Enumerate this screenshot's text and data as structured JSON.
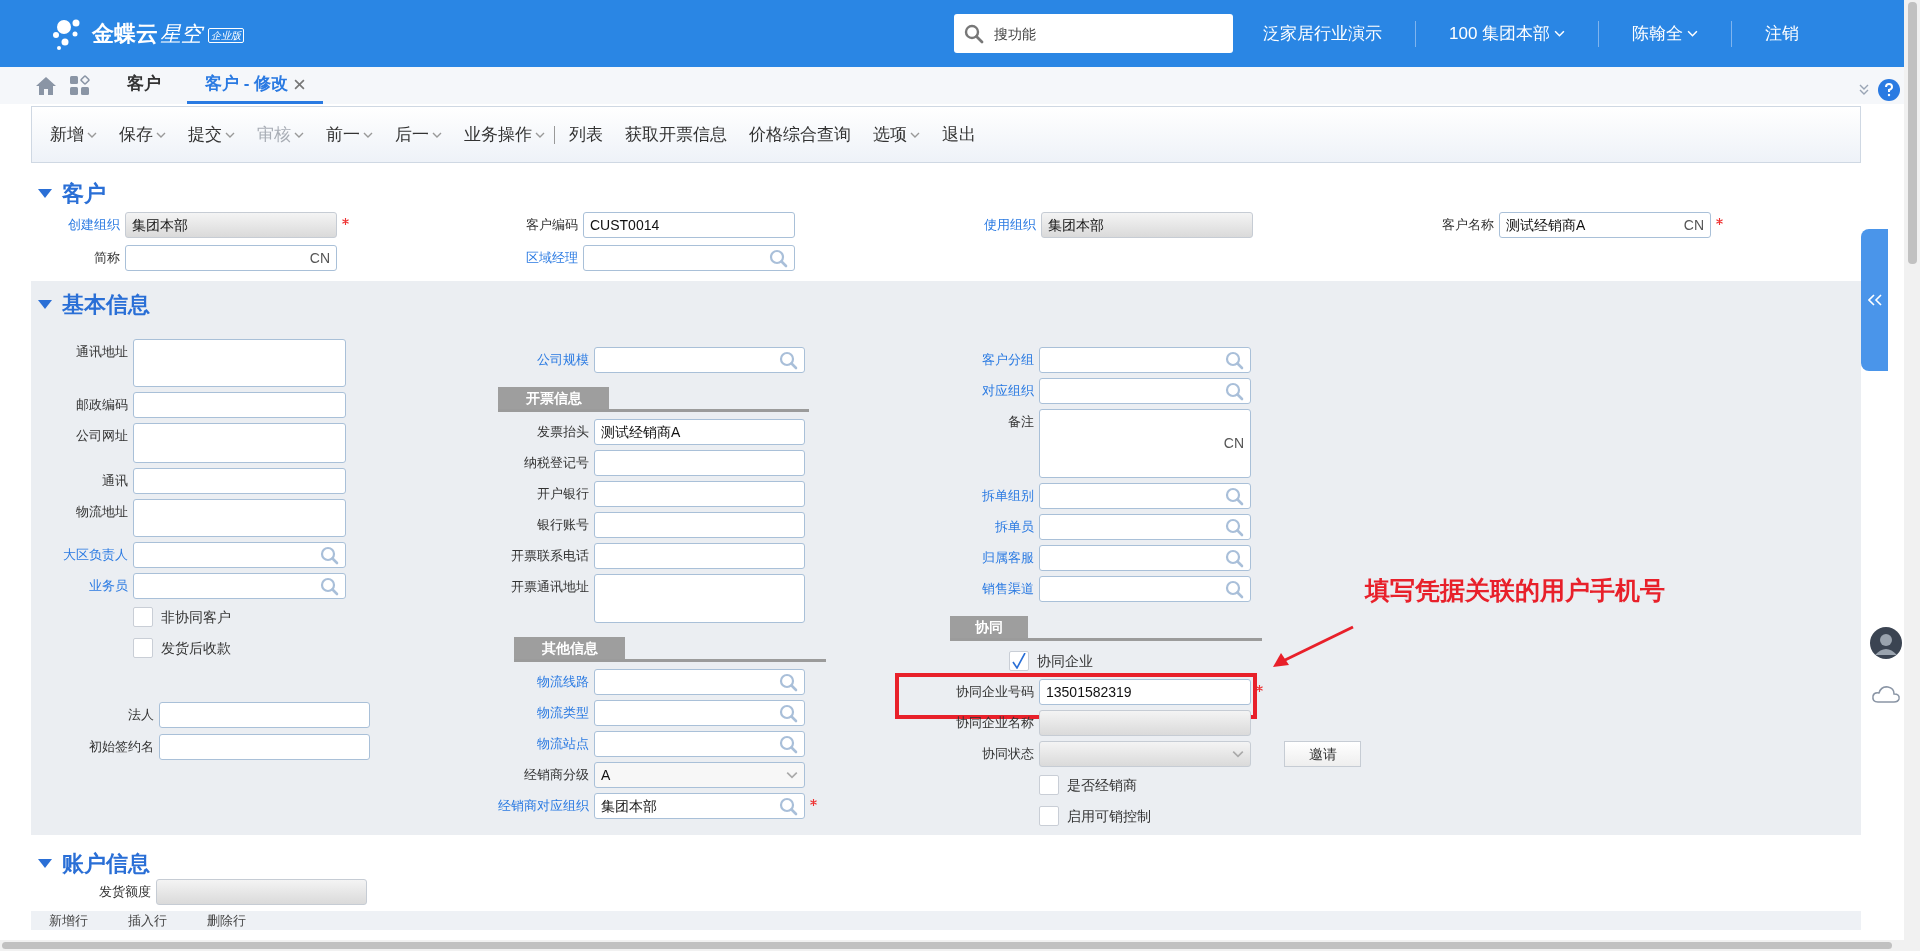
{
  "topbar": {
    "logo_name": "金蝶云",
    "logo_product": "星空",
    "logo_edition": "企业版",
    "search": {
      "placeholder": "搜功能"
    },
    "items": [
      {
        "label": "泛家居行业演示",
        "dropdown": false
      },
      {
        "label": "100 集团本部",
        "dropdown": true
      },
      {
        "label": "陈翰全",
        "dropdown": true
      },
      {
        "label": "注销",
        "dropdown": false
      }
    ]
  },
  "tabs": [
    {
      "label": "客户",
      "selected": false,
      "closable": false
    },
    {
      "label": "客户 - 修改",
      "selected": true,
      "closable": true
    }
  ],
  "toolbar": [
    {
      "label": "新增",
      "dropdown": true,
      "disabled": false,
      "separator_after": false
    },
    {
      "label": "保存",
      "dropdown": true,
      "disabled": false,
      "separator_after": false
    },
    {
      "label": "提交",
      "dropdown": true,
      "disabled": false,
      "separator_after": false
    },
    {
      "label": "审核",
      "dropdown": true,
      "disabled": true,
      "separator_after": false
    },
    {
      "label": "前一",
      "dropdown": true,
      "disabled": false,
      "separator_after": false
    },
    {
      "label": "后一",
      "dropdown": true,
      "disabled": false,
      "separator_after": false
    },
    {
      "label": "业务操作",
      "dropdown": true,
      "disabled": false,
      "separator_after": true
    },
    {
      "label": "列表",
      "dropdown": false,
      "disabled": false,
      "separator_after": false
    },
    {
      "label": "获取开票信息",
      "dropdown": false,
      "disabled": false,
      "separator_after": false
    },
    {
      "label": "价格综合查询",
      "dropdown": false,
      "disabled": false,
      "separator_after": false
    },
    {
      "label": "选项",
      "dropdown": true,
      "disabled": false,
      "separator_after": false
    },
    {
      "label": "退出",
      "dropdown": false,
      "disabled": false,
      "separator_after": false
    }
  ],
  "customer_section": {
    "title": "客户",
    "rows": [
      [
        {
          "label": "创建组织",
          "link": true,
          "kind": "text",
          "value": "集团本部",
          "disabled": true,
          "required": true
        },
        {
          "label": "客户编码",
          "link": false,
          "kind": "text",
          "value": "CUST0014",
          "disabled": false,
          "required": false
        },
        {
          "label": "使用组织",
          "link": true,
          "kind": "text",
          "value": "集团本部",
          "disabled": true,
          "required": false
        },
        {
          "label": "客户名称",
          "link": false,
          "kind": "text",
          "value": "测试经销商A",
          "suffix": "CN",
          "disabled": false,
          "required": true
        }
      ],
      [
        {
          "label": "简称",
          "link": false,
          "kind": "text",
          "suffix": "CN",
          "disabled": false,
          "required": false
        },
        {
          "label": "区域经理",
          "link": true,
          "kind": "lookup",
          "disabled": false,
          "required": false
        }
      ]
    ]
  },
  "basic_info": {
    "title": "基本信息",
    "columns": [
      {
        "items": [
          {
            "label": "通讯地址",
            "link": false,
            "kind": "textarea"
          },
          {
            "label": "邮政编码",
            "link": false,
            "kind": "text"
          },
          {
            "label": "公司网址",
            "link": false,
            "kind": "textarea"
          },
          {
            "label": "通讯",
            "link": false,
            "kind": "text"
          },
          {
            "label": "物流地址",
            "link": false,
            "kind": "textarea"
          },
          {
            "label": "大区负责人",
            "link": true,
            "kind": "lookup"
          },
          {
            "label": "业务员",
            "link": true,
            "kind": "lookup"
          },
          {
            "label": "非协同客户",
            "kind": "checkbox",
            "checked": false
          },
          {
            "label": "发货后收款",
            "kind": "checkbox",
            "checked": false
          }
        ]
      },
      {
        "items": [
          {
            "label": "公司规模",
            "link": true,
            "kind": "lookup"
          },
          {
            "label": "开票信息",
            "kind": "section"
          },
          {
            "label": "发票抬头",
            "link": false,
            "kind": "text",
            "value": "测试经销商A"
          },
          {
            "label": "纳税登记号",
            "link": false,
            "kind": "text"
          },
          {
            "label": "开户银行",
            "link": false,
            "kind": "text"
          },
          {
            "label": "银行账号",
            "link": false,
            "kind": "text"
          },
          {
            "label": "开票联系电话",
            "link": false,
            "kind": "text"
          },
          {
            "label": "开票通讯地址",
            "link": false,
            "kind": "textarea"
          },
          {
            "label": "其他信息",
            "kind": "section"
          },
          {
            "label": "物流线路",
            "link": true,
            "kind": "lookup"
          },
          {
            "label": "物流类型",
            "link": true,
            "kind": "lookup"
          },
          {
            "label": "物流站点",
            "link": true,
            "kind": "lookup"
          },
          {
            "label": "经销商分级",
            "link": false,
            "kind": "select",
            "value": "A"
          },
          {
            "label": "经销商对应组织",
            "link": true,
            "kind": "lookup",
            "value": "集团本部",
            "required": true
          }
        ]
      },
      {
        "items": [
          {
            "label": "客户分组",
            "link": true,
            "kind": "lookup"
          },
          {
            "label": "对应组织",
            "link": true,
            "kind": "lookup"
          },
          {
            "label": "备注",
            "link": false,
            "kind": "textarea",
            "suffix": "CN"
          },
          {
            "label": "拆单组别",
            "link": true,
            "kind": "lookup"
          },
          {
            "label": "拆单员",
            "link": true,
            "kind": "lookup"
          },
          {
            "label": "归属客服",
            "link": true,
            "kind": "lookup"
          },
          {
            "label": "销售渠道",
            "link": true,
            "kind": "lookup"
          },
          {
            "label": "协同",
            "kind": "section"
          },
          {
            "label": "协同企业",
            "kind": "checkbox",
            "checked": true
          },
          {
            "label": "协同企业号码",
            "link": false,
            "kind": "text",
            "value": "13501582319",
            "required": true,
            "highlighted": true
          },
          {
            "label": "协同企业名称",
            "link": false,
            "kind": "text",
            "disabled": true
          },
          {
            "label": "协同状态",
            "link": false,
            "kind": "select",
            "disabled": true,
            "action": "邀请"
          },
          {
            "label": "是否经销商",
            "kind": "checkbox",
            "checked": false
          },
          {
            "label": "启用可销控制",
            "kind": "checkbox",
            "checked": false
          }
        ]
      }
    ],
    "lower_items": [
      {
        "label": "法人",
        "link": false,
        "kind": "text"
      },
      {
        "label": "初始签约名",
        "link": false,
        "kind": "text"
      }
    ]
  },
  "annotation": {
    "text": "填写凭据关联的用户手机号"
  },
  "account_section": {
    "title": "账户信息",
    "fields": [
      {
        "label": "发货额度",
        "link": false,
        "kind": "text",
        "disabled": true
      }
    ],
    "grid_toolbar": [
      "新增行",
      "插入行",
      "删除行"
    ]
  }
}
